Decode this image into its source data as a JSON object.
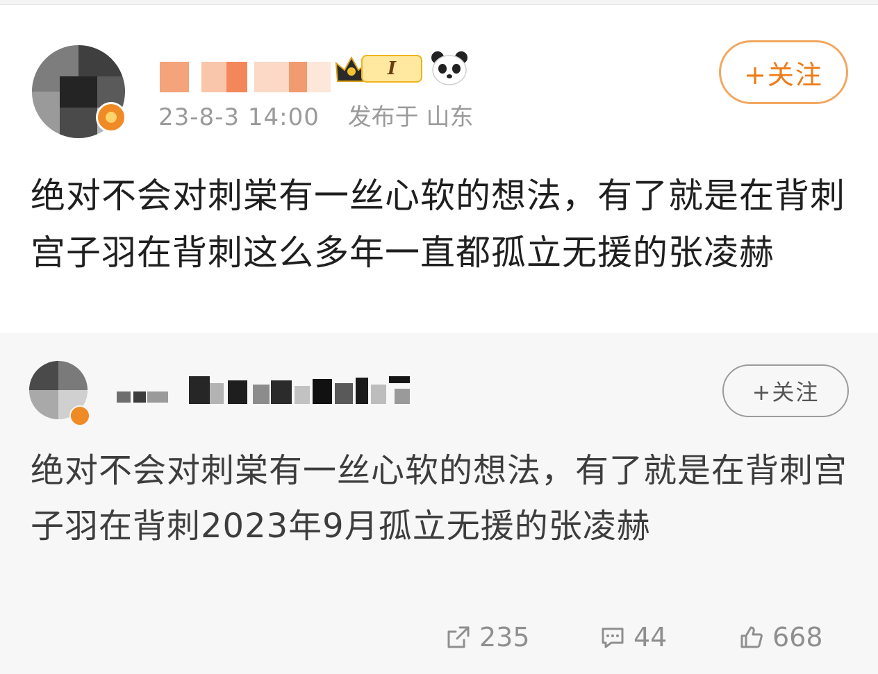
{
  "post": {
    "timestamp": "23-8-3 14:00",
    "location": "发布于 山东",
    "level": "I",
    "follow_label": "+关注",
    "text": "绝对不会对刺棠有一丝心软的想法，有了就是在背刺宫子羽在背刺这么多年一直都孤立无援的张凌赫"
  },
  "repost": {
    "follow_label": "+关注",
    "text": "绝对不会对刺棠有一丝心软的想法，有了就是在背刺宫子羽在背刺2023年9月孤立无援的张凌赫"
  },
  "actions": {
    "share_count": "235",
    "comment_count": "44",
    "like_count": "668"
  },
  "icons": {
    "share": "share-icon",
    "comment": "comment-icon",
    "like": "like-icon",
    "crown": "crown-icon",
    "panda": "panda-icon"
  },
  "colors": {
    "accent": "#ee7b18",
    "muted": "#9a9a9a",
    "repost_bg": "#f7f7f7"
  }
}
